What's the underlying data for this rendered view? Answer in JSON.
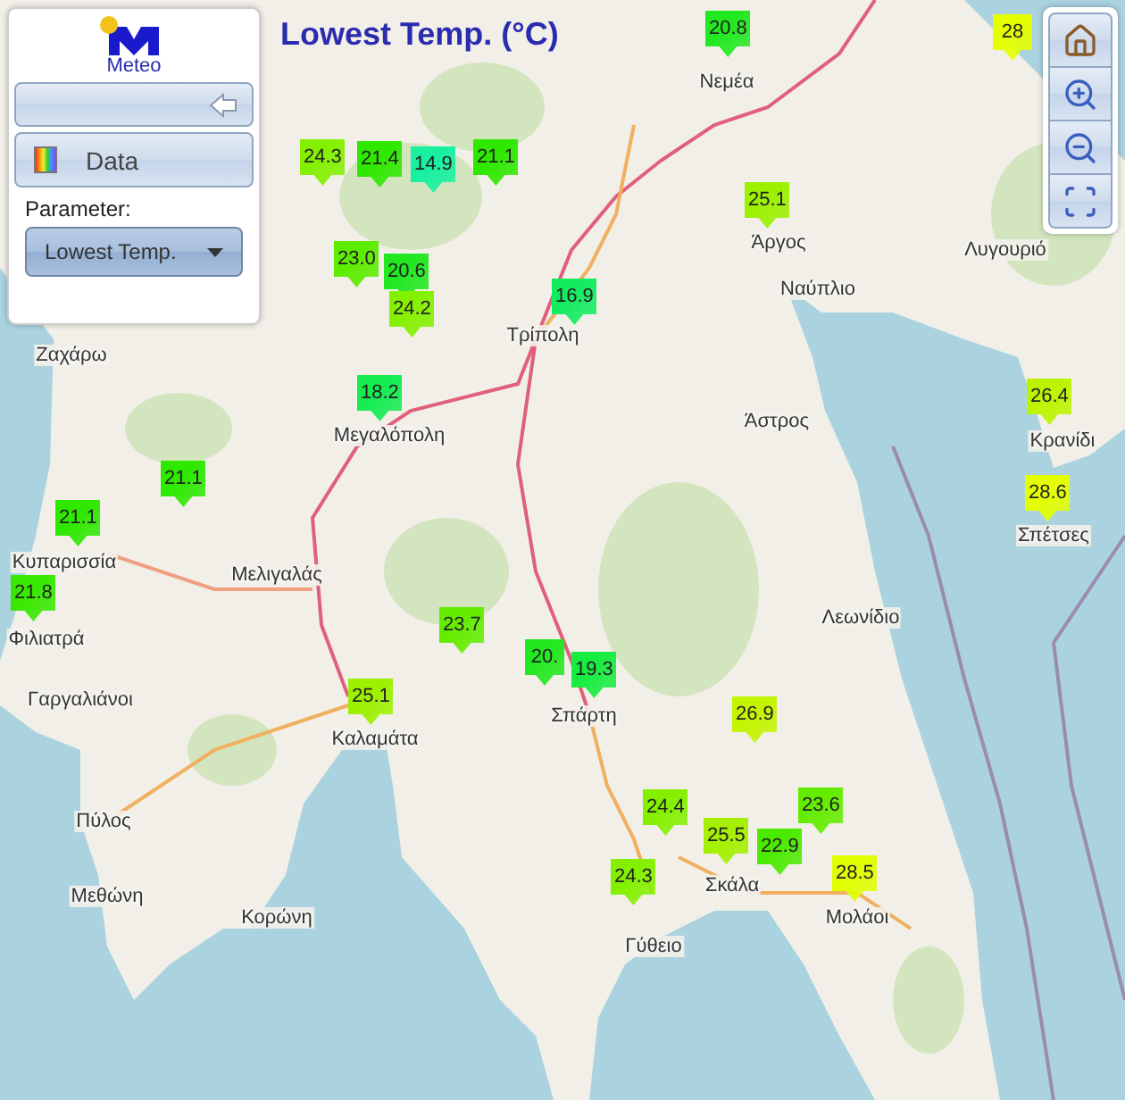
{
  "title": "Lowest Temp. (°C)",
  "panel": {
    "logo_text": "Meteo",
    "data_button": "Data",
    "parameter_label": "Parameter:",
    "parameter_select": {
      "value": "Lowest Temp."
    }
  },
  "map_controls": [
    {
      "kind": "home"
    },
    {
      "kind": "zoom_in"
    },
    {
      "kind": "zoom_out"
    },
    {
      "kind": "full_extent"
    }
  ],
  "places": [
    "Νεμέα",
    "Άργος",
    "Ναύπλιο",
    "Λυγουριό",
    "Τρίπολη",
    "Μεγαλόπολη",
    "Ζαχάρω",
    "Κυπαρισσία",
    "Μελιγαλάς",
    "Φιλιατρά",
    "Γαργαλιάνοι",
    "Καλαμάτα",
    "Σπάρτη",
    "Άστρος",
    "Κρανίδι",
    "Σπέτσες",
    "Λεωνίδιο",
    "Πύλος",
    "Μεθώνη",
    "Κορώνη",
    "Γύθειο",
    "Σκάλα",
    "Μολάοι"
  ],
  "markers": [
    {
      "value": "24.3",
      "color": "#84f000"
    },
    {
      "value": "21.4",
      "color": "#2ee800"
    },
    {
      "value": "14.9",
      "color": "#18f0a0"
    },
    {
      "value": "21.1",
      "color": "#2ee800"
    },
    {
      "value": "20.8",
      "color": "#22e820"
    },
    {
      "value": "28",
      "color": "#e4ff00"
    },
    {
      "value": "25.1",
      "color": "#9cf000"
    },
    {
      "value": "23.0",
      "color": "#5cec00"
    },
    {
      "value": "20.6",
      "color": "#22e820"
    },
    {
      "value": "24.2",
      "color": "#84f000"
    },
    {
      "value": "16.9",
      "color": "#14ec60"
    },
    {
      "value": "18.2",
      "color": "#14ec50"
    },
    {
      "value": "21.1",
      "color": "#2ee800"
    },
    {
      "value": "21.1",
      "color": "#2ee800"
    },
    {
      "value": "21.8",
      "color": "#38e800"
    },
    {
      "value": "23.7",
      "color": "#64ec00"
    },
    {
      "value": "20.",
      "color": "#22e820"
    },
    {
      "value": "19.3",
      "color": "#18ec40"
    },
    {
      "value": "25.1",
      "color": "#9cf000"
    },
    {
      "value": "26.9",
      "color": "#c4f400"
    },
    {
      "value": "24.4",
      "color": "#84f000"
    },
    {
      "value": "23.6",
      "color": "#64ec00"
    },
    {
      "value": "25.5",
      "color": "#a4f000"
    },
    {
      "value": "22.9",
      "color": "#4cea00"
    },
    {
      "value": "24.3",
      "color": "#84f000"
    },
    {
      "value": "28.5",
      "color": "#e0ff00"
    },
    {
      "value": "26.4",
      "color": "#bcf400"
    },
    {
      "value": "28.6",
      "color": "#e4ff00"
    }
  ]
}
